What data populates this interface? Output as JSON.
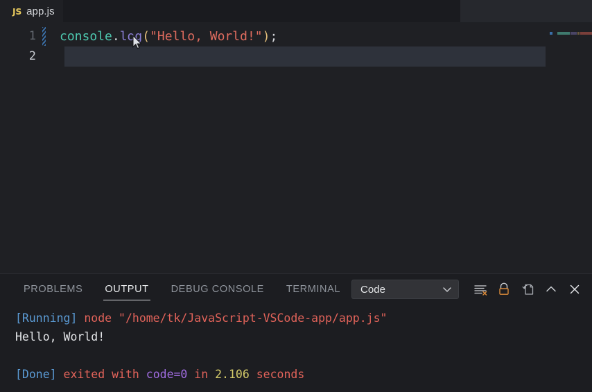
{
  "window": {
    "app": "Visual Studio Code",
    "theme_bg": "#1f2024",
    "accent": "#5b9bd5"
  },
  "editor_tabs": [
    {
      "icon": "js-file-icon",
      "icon_label": "JS",
      "label": "app.js",
      "active": true
    }
  ],
  "editor": {
    "language": "javascript",
    "lines": [
      {
        "number": "1",
        "has_diff_marker": true,
        "tokens": [
          {
            "text": "console",
            "kind": "obj"
          },
          {
            "text": ".",
            "kind": "punct"
          },
          {
            "text": "log",
            "kind": "fn"
          },
          {
            "text": "(",
            "kind": "paren"
          },
          {
            "text": "\"Hello, World!\"",
            "kind": "string"
          },
          {
            "text": ")",
            "kind": "paren"
          },
          {
            "text": ";",
            "kind": "punct"
          }
        ],
        "plain": "console.log(\"Hello, World!\");"
      },
      {
        "number": "2",
        "has_diff_marker": false,
        "selected": true,
        "tokens": [],
        "plain": ""
      }
    ],
    "cursor_line": "2",
    "minimap": {
      "visible": true,
      "blocks": [
        {
          "color": "#3a6fa8",
          "width": 4
        },
        {
          "color": "#1f2024",
          "width": 5
        },
        {
          "color": "#3f7a6e",
          "width": 18
        },
        {
          "color": "#4a4566",
          "width": 9
        },
        {
          "color": "#6b5a3f",
          "width": 3
        },
        {
          "color": "#7a3f3a",
          "width": 22
        },
        {
          "color": "#6b5a3f",
          "width": 3
        },
        {
          "color": "#4a4c52",
          "width": 3
        }
      ]
    }
  },
  "panel": {
    "tabs": [
      {
        "label": "PROBLEMS",
        "active": false
      },
      {
        "label": "OUTPUT",
        "active": true
      },
      {
        "label": "DEBUG CONSOLE",
        "active": false
      },
      {
        "label": "TERMINAL",
        "active": false
      }
    ],
    "channel_select": {
      "value": "Code",
      "icon": "chevron-down-icon"
    },
    "actions": [
      {
        "name": "clear-output-icon",
        "title": "Clear Output"
      },
      {
        "name": "lock-scroll-icon",
        "title": "Turn Auto Scrolling Off"
      },
      {
        "name": "open-in-editor-icon",
        "title": "Open Output in Editor"
      },
      {
        "name": "maximize-panel-icon",
        "title": "Maximize Panel Size"
      },
      {
        "name": "close-panel-icon",
        "title": "Close Panel"
      }
    ],
    "output_lines": [
      {
        "segments": [
          {
            "text": "[Running]",
            "kind": "tag"
          },
          {
            "text": " ",
            "kind": "plain"
          },
          {
            "text": "node \"/home/tk/JavaScript-VSCode-app/app.js\"",
            "kind": "red"
          }
        ]
      },
      {
        "segments": [
          {
            "text": "Hello, World!",
            "kind": "plain"
          }
        ]
      },
      {
        "segments": [
          {
            "text": "",
            "kind": "plain"
          }
        ]
      },
      {
        "segments": [
          {
            "text": "[Done]",
            "kind": "tag"
          },
          {
            "text": " ",
            "kind": "plain"
          },
          {
            "text": "exited with ",
            "kind": "red"
          },
          {
            "text": "code=0",
            "kind": "purple"
          },
          {
            "text": " in ",
            "kind": "red"
          },
          {
            "text": "2.106",
            "kind": "time"
          },
          {
            "text": " seconds",
            "kind": "red"
          }
        ]
      }
    ]
  }
}
